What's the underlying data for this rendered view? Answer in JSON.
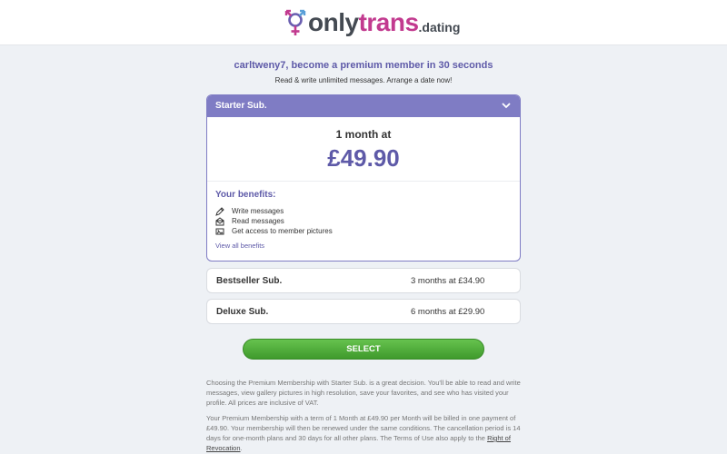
{
  "logo": {
    "part1": "only",
    "part2": "trans",
    "part3": ".dating",
    "symbol_icon": "transgender-symbol-icon",
    "colors": {
      "dark": "#444a52",
      "pink": "#c23a8f",
      "blue": "#5aa0d8"
    }
  },
  "intro": {
    "headline": "carltweny7, become a premium member in 30 seconds",
    "subline": "Read & write unlimited messages. Arrange a date now!"
  },
  "selected_plan": {
    "name": "Starter Sub.",
    "price_label": "1 month at",
    "price": "£49.90",
    "benefits_title": "Your benefits:",
    "benefits": [
      {
        "icon": "pencil-icon",
        "label": "Write messages"
      },
      {
        "icon": "envelope-open-icon",
        "label": "Read messages"
      },
      {
        "icon": "image-icon",
        "label": "Get access to member pictures"
      }
    ],
    "view_all": "View all benefits"
  },
  "other_plans": [
    {
      "name": "Bestseller Sub.",
      "terms": "3 months at £34.90"
    },
    {
      "name": "Deluxe Sub.",
      "terms": "6 months at £29.90"
    }
  ],
  "select_button": "SELECT",
  "disclaimer": {
    "para1": "Choosing the Premium Membership with Starter Sub. is a great decision. You'll be able to read and write messages, view gallery pictures in high resolution, save your favorites, and see who has visited your profile. All prices are inclusive of VAT.",
    "para2": "Your Premium Membership with a term of 1 Month at £49.90 per Month will be billed in one payment of £49.90. Your membership will then be renewed under the same conditions. The cancellation period is 14 days for one-month plans and 30 days for all other plans. The Terms of Use also apply to the",
    "link": "Right of Revocation",
    "link_suffix": "."
  },
  "colors": {
    "accent": "#7f7cc4",
    "accent_text": "#5e5aa8",
    "button_green": "#4caf3a",
    "background": "#eef1f5"
  }
}
